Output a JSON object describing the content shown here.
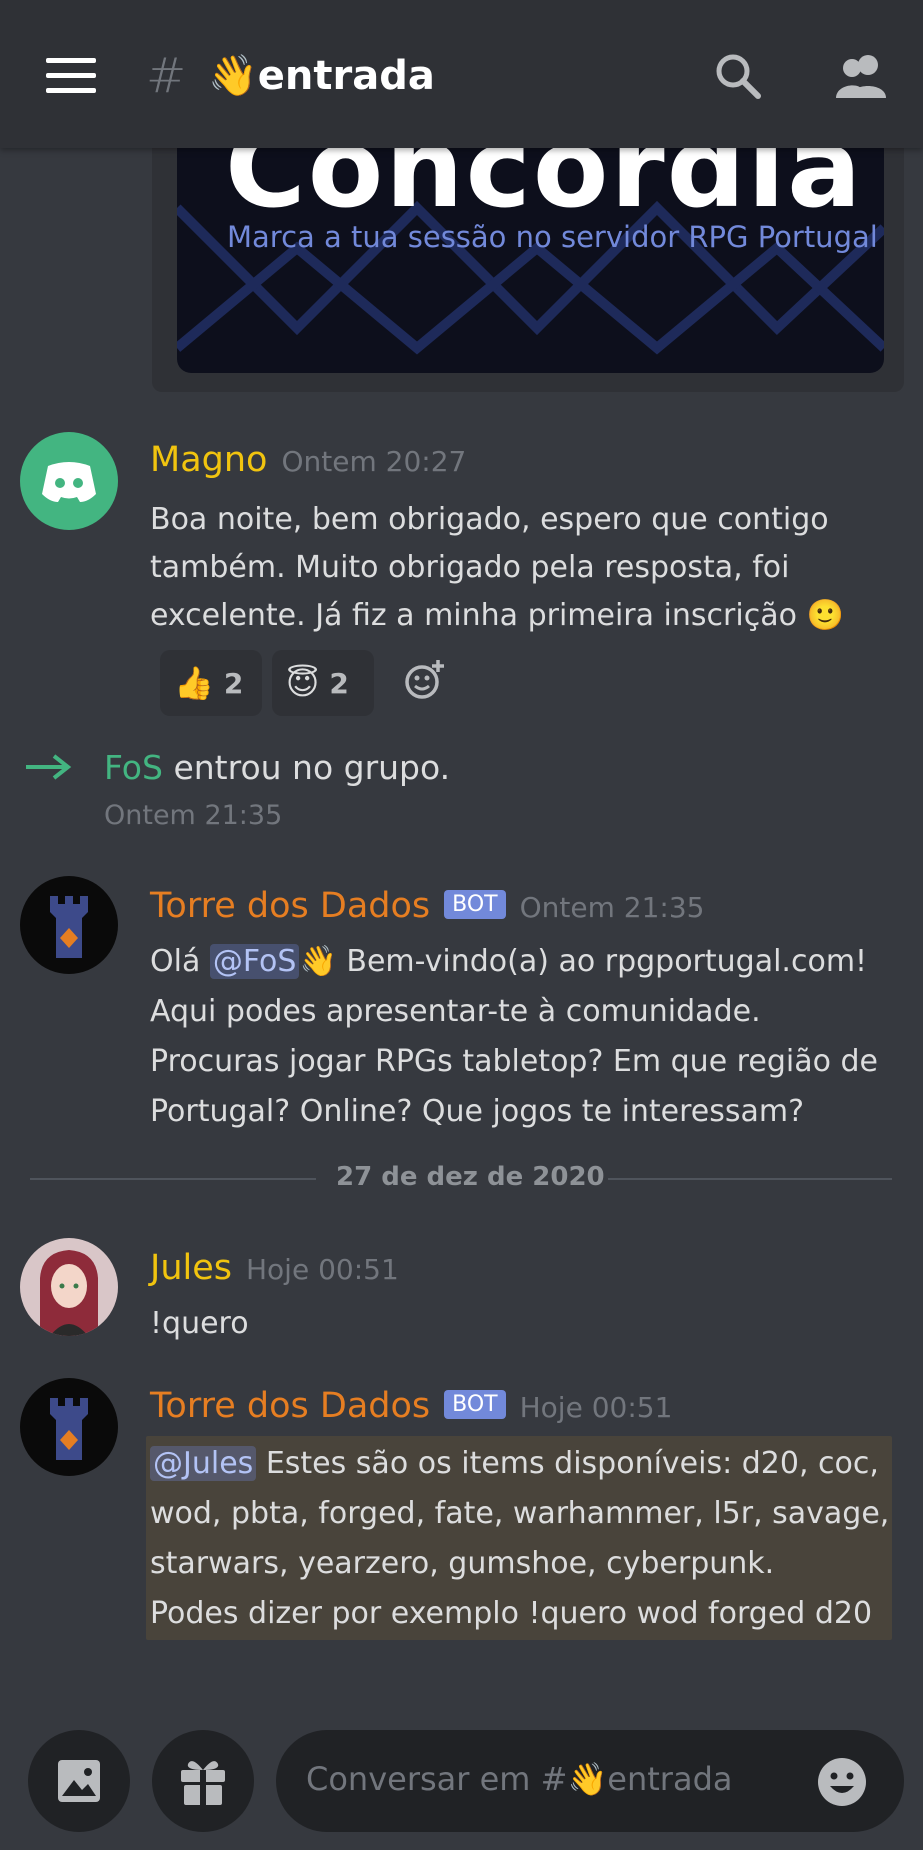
{
  "header": {
    "channel_hash": "#",
    "channel_name": "👋entrada"
  },
  "embed": {
    "logo_text": "Concórdia",
    "subtitle": "Marca a tua sessão no servidor RPG Portugal"
  },
  "messages": [
    {
      "author": "Magno",
      "author_color": "#f1c40f",
      "timestamp": "Ontem 20:27",
      "lines": [
        "Boa noite, bem obrigado, espero que contigo",
        "também. Muito obrigado pela resposta, foi",
        "excelente. Já fiz a minha primeira inscrição 🙂"
      ],
      "reactions": [
        {
          "emoji": "👍",
          "count": "2"
        },
        {
          "emoji": "😇",
          "count": "2"
        }
      ]
    },
    {
      "system": true,
      "user": "FoS",
      "user_color": "#43b581",
      "text": " entrou no grupo.",
      "timestamp": "Ontem 21:35"
    },
    {
      "author": "Torre dos Dados",
      "author_color": "#e67e22",
      "bot_tag": "BOT",
      "timestamp": "Ontem 21:35",
      "line1_prefix": "Olá ",
      "line1_mention": "@FoS",
      "line1_suffix": "👋 Bem-vindo(a) ao rpgportugal.com!",
      "lines": [
        "Aqui podes apresentar-te à comunidade.",
        "Procuras jogar RPGs tabletop? Em que região de",
        "Portugal? Online? Que jogos te interessam?"
      ]
    },
    {
      "author": "Jules",
      "author_color": "#f1c40f",
      "timestamp": "Hoje 00:51",
      "lines": [
        "!quero"
      ]
    },
    {
      "author": "Torre dos Dados",
      "author_color": "#e67e22",
      "bot_tag": "BOT",
      "timestamp": "Hoje 00:51",
      "line1_mention": "@Jules",
      "line1_suffix": " Estes são os items disponíveis: d20, coc,",
      "lines": [
        "wod, pbta, forged, fate, warhammer, l5r, savage,",
        "starwars, yearzero, gumshoe, cyberpunk.",
        " Podes dizer por exemplo !quero wod forged d20"
      ]
    }
  ],
  "date_divider": "27 de dez de 2020",
  "composer": {
    "placeholder": "Conversar em #👋entrada"
  },
  "colors": {
    "background": "#36393f",
    "header": "#2f3136",
    "mention": "#7289da",
    "join_arrow": "#43b581"
  }
}
